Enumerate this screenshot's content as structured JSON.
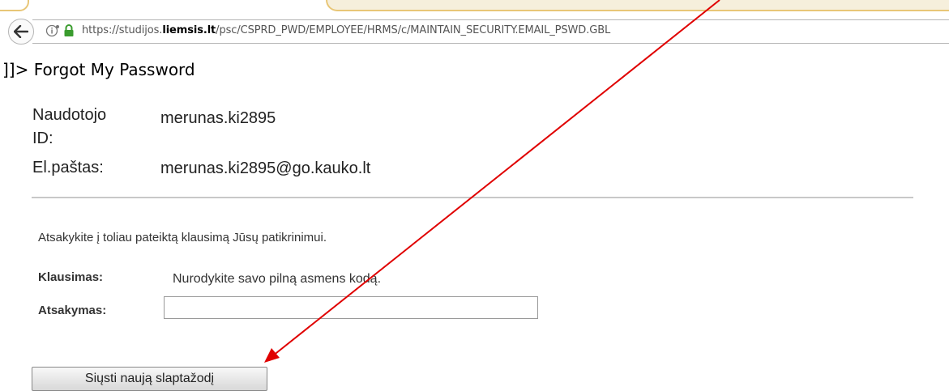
{
  "browser": {
    "url_prefix": "https://studijos.",
    "url_host_bold": "liemsis.lt",
    "url_path": "/psc/CSPRD_PWD/EMPLOYEE/HRMS/c/MAINTAIN_SECURITY.EMAIL_PSWD.GBL"
  },
  "page": {
    "title": "]]> Forgot My Password"
  },
  "user": {
    "id_label_line1": "Naudotojo",
    "id_label_line2": "ID:",
    "id_value": "merunas.ki2895",
    "email_label": "El.paštas:",
    "email_value": "merunas.ki2895@go.kauko.lt"
  },
  "form": {
    "instruction": "Atsakykite į toliau pateiktą klausimą Jūsų patikrinimui.",
    "question_label": "Klausimas:",
    "question_value": "Nurodykite savo pilną asmens kodą.",
    "answer_label": "Atsakymas:",
    "answer_value": "",
    "submit_label": "Siųsti naują slaptažodį"
  },
  "colors": {
    "annotation_arrow": "#e00000",
    "tab_border": "#e8c677"
  }
}
